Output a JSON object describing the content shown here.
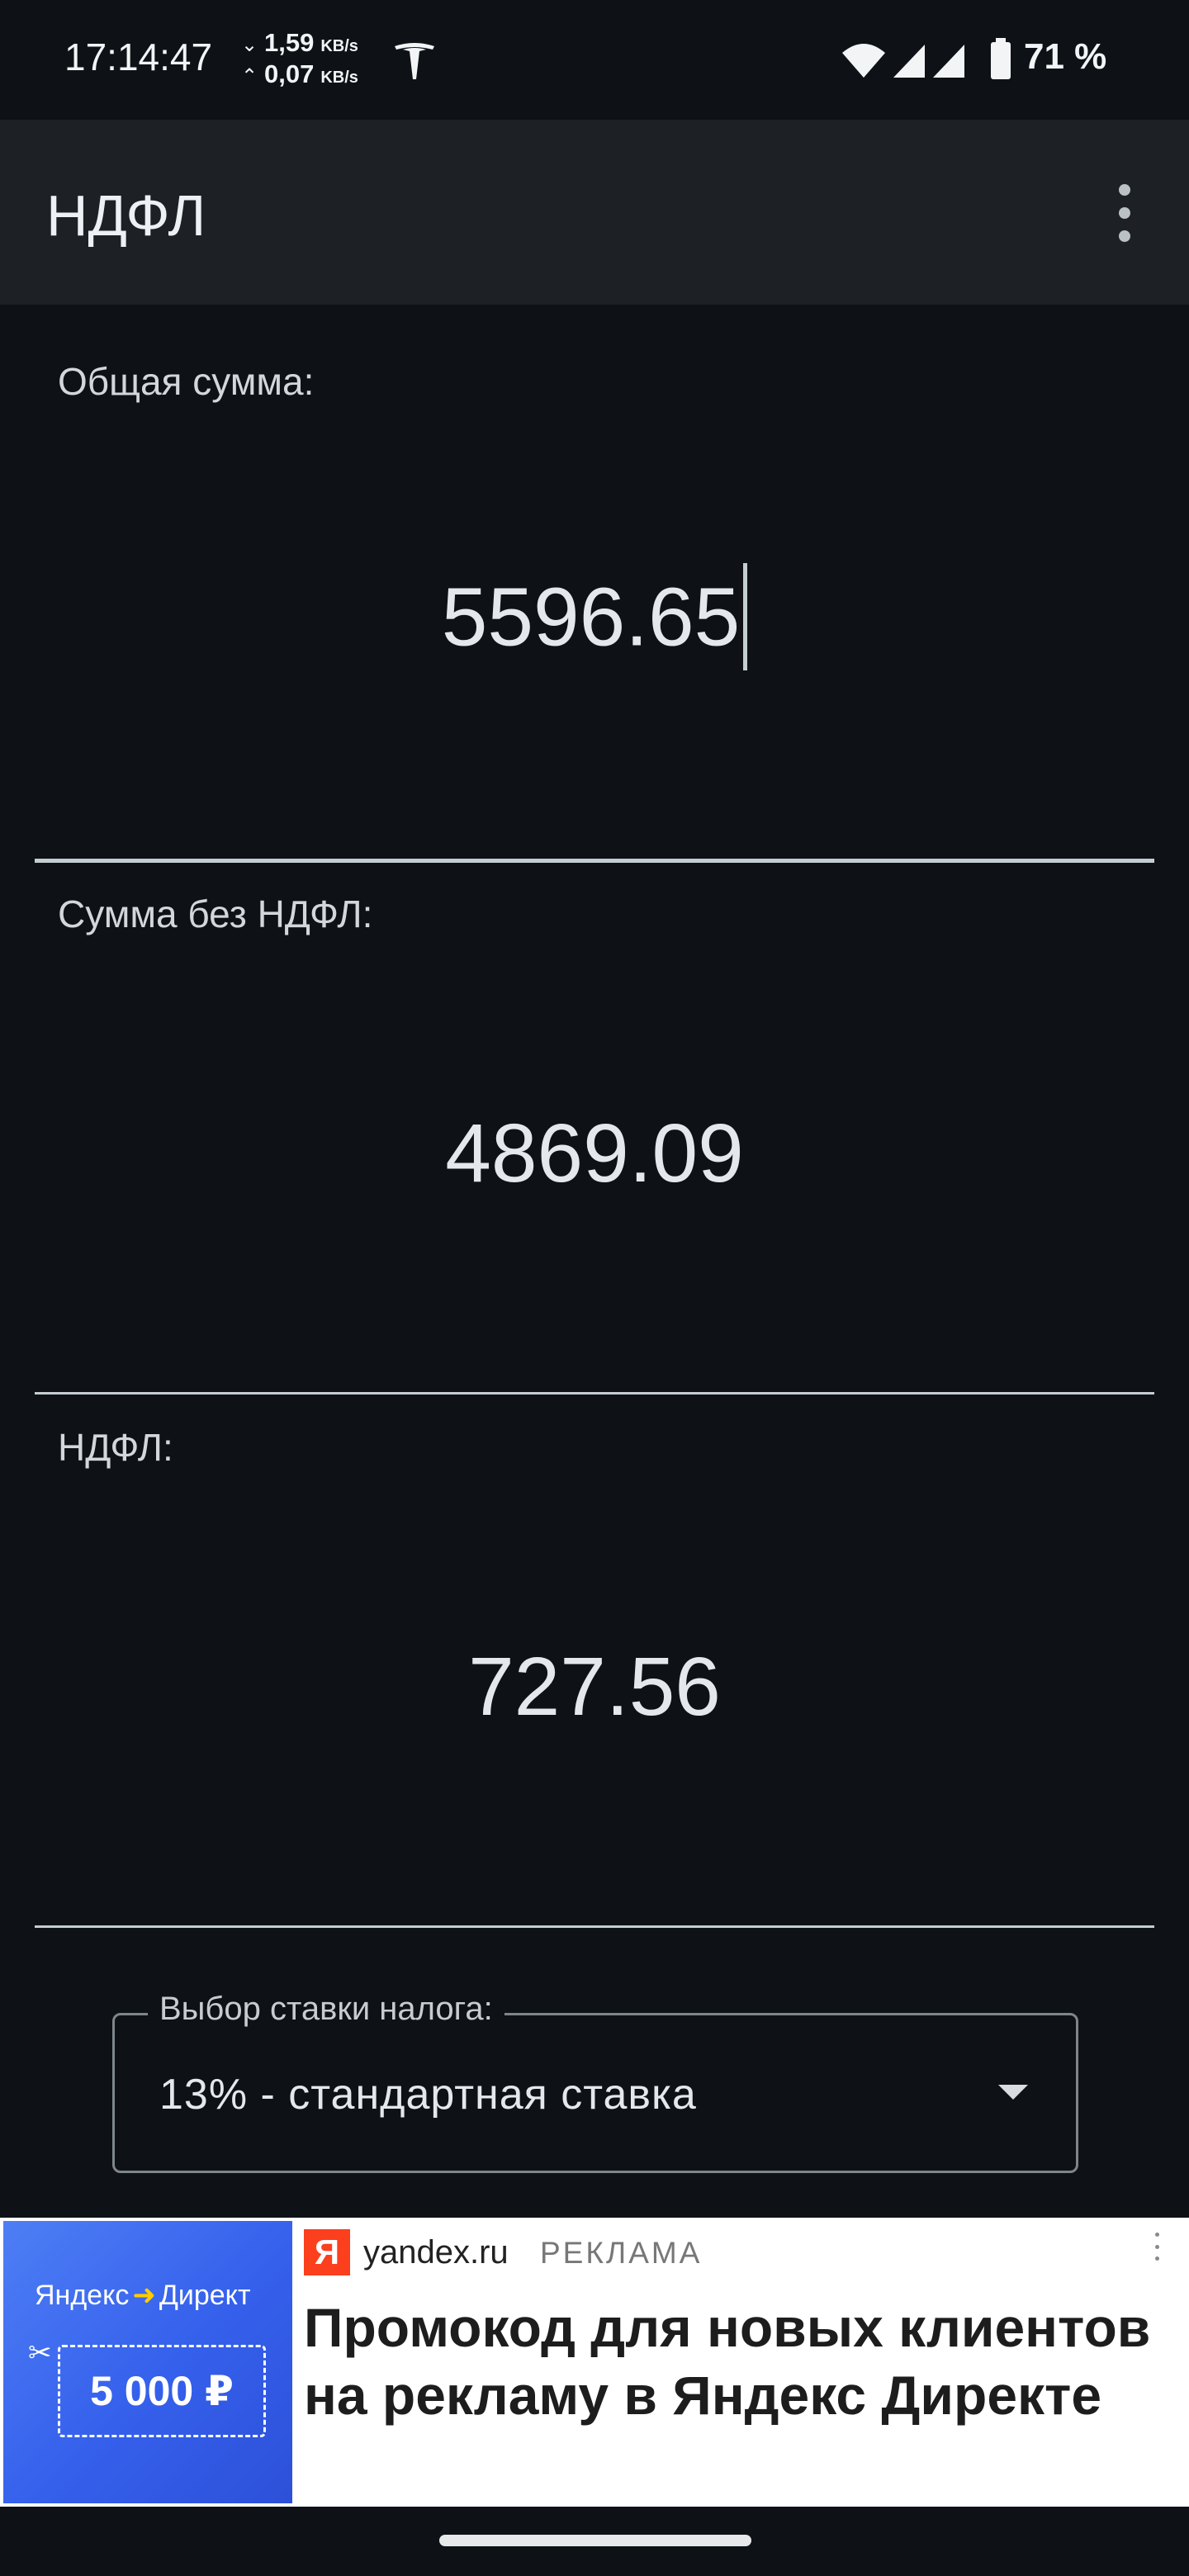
{
  "status_bar": {
    "time": "17:14:47",
    "download_speed": "1,59",
    "upload_speed": "0,07",
    "speed_unit": "KB/s",
    "battery": "71 %"
  },
  "app_bar": {
    "title": "НДФЛ"
  },
  "fields": {
    "total": {
      "label": "Общая сумма:",
      "value": "5596.65"
    },
    "net": {
      "label": "Сумма без НДФЛ:",
      "value": "4869.09"
    },
    "tax": {
      "label": "НДФЛ:",
      "value": "727.56"
    }
  },
  "tax_rate": {
    "label": "Выбор ставки налога:",
    "selected": "13% - стандартная ставка"
  },
  "ad": {
    "brand_left": "Яндекс",
    "brand_right": "Директ",
    "coupon": "5 000 ₽",
    "favicon": "Я",
    "domain": "yandex.ru",
    "label": "РЕКЛАМА",
    "headline": "Промокод для новых клиентов на рекламу в Яндекс Директе"
  },
  "colors": {
    "background": "#0e1216",
    "app_bar": "#1d2125",
    "accent_line": "#c4cdd2",
    "ad_blue": "#3560ec",
    "yandex_red": "#fc3f1d"
  },
  "icons": [
    "tesla-icon",
    "wifi-icon",
    "signal-icon",
    "battery-icon",
    "more-vert-icon",
    "dropdown-caret-icon",
    "scissors-icon",
    "ad-menu-icon"
  ]
}
